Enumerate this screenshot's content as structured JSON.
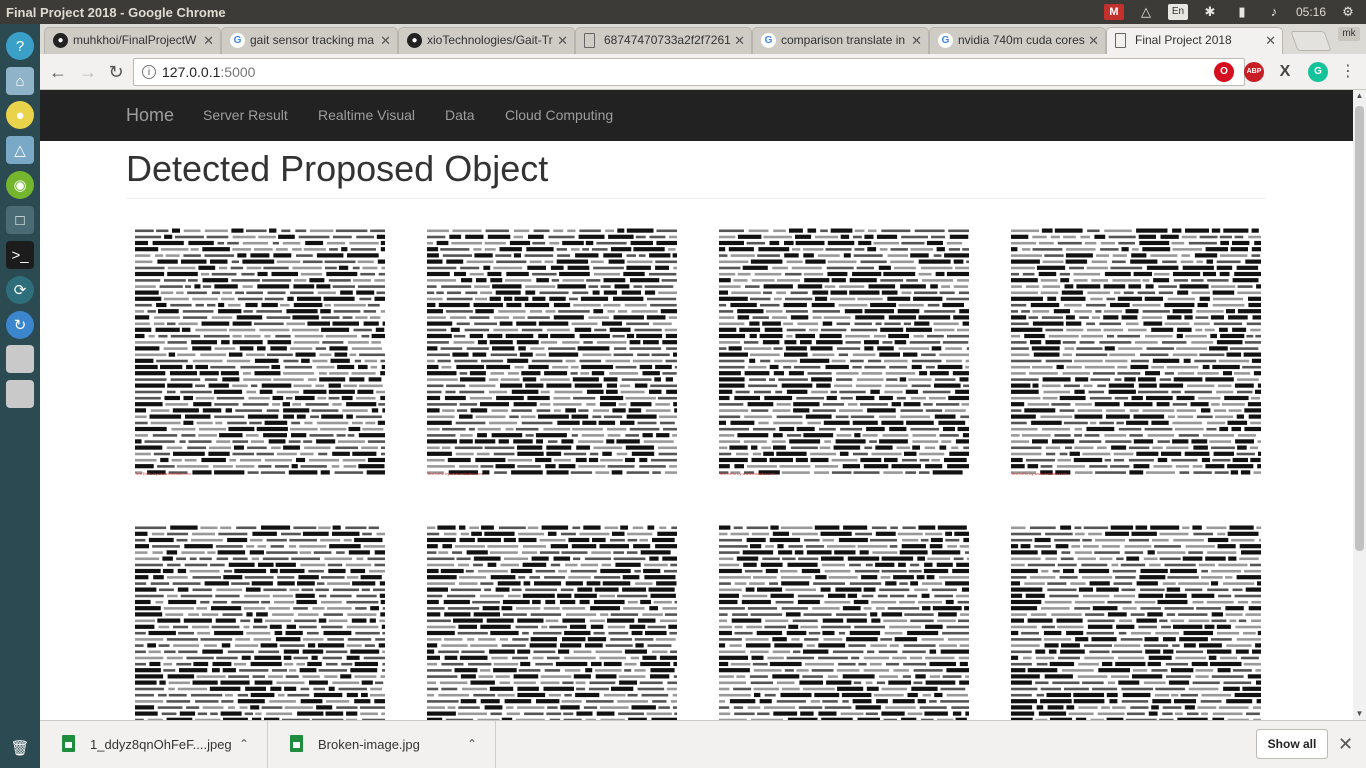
{
  "os": {
    "window_title": "Final Project 2018 - Google Chrome",
    "keyboard_layout": "En",
    "clock": "05:16"
  },
  "launcher": {
    "items": [
      "help-icon",
      "files-icon",
      "chrome-icon",
      "wifi-settings-icon",
      "nvidia-icon",
      "camera-icon",
      "terminal-icon",
      "update-icon",
      "sync-icon",
      "drive-icon",
      "drive-icon",
      "trash-icon"
    ]
  },
  "tabs": [
    {
      "title": "muhkhoi/FinalProjectW",
      "icon": "github-icon"
    },
    {
      "title": "gait sensor tracking ma",
      "icon": "google-icon"
    },
    {
      "title": "xioTechnologies/Gait-Tr",
      "icon": "github-icon"
    },
    {
      "title": "68747470733a2f2f7261",
      "icon": "document-icon"
    },
    {
      "title": "comparison translate in",
      "icon": "google-icon"
    },
    {
      "title": "nvidia 740m cuda cores",
      "icon": "google-icon"
    },
    {
      "title": "Final Project 2018",
      "icon": "document-icon",
      "active": true
    }
  ],
  "profile_chip": "mk",
  "address": {
    "host": "127.0.0.1",
    "port": ":5000"
  },
  "extensions": [
    {
      "name": "opera-icon",
      "label": "O",
      "color": "#d50f1f"
    },
    {
      "name": "adblock-icon",
      "label": "ABP",
      "color": "#c71e25"
    },
    {
      "name": "x-extension-icon",
      "label": "X",
      "color": "#444444"
    },
    {
      "name": "grammarly-icon",
      "label": "G",
      "color": "#15c39a"
    }
  ],
  "site": {
    "brand": "Home",
    "nav": [
      "Server Result",
      "Realtime Visual",
      "Data",
      "Cloud Computing"
    ],
    "title": "Detected Proposed Object",
    "image_caption": "TextToPic by www.mezaka.com"
  },
  "downloads": [
    {
      "name": "1_ddyz8qnOhFeF....jpeg"
    },
    {
      "name": "Broken-image.jpg"
    }
  ],
  "shelf": {
    "show_all": "Show all"
  }
}
